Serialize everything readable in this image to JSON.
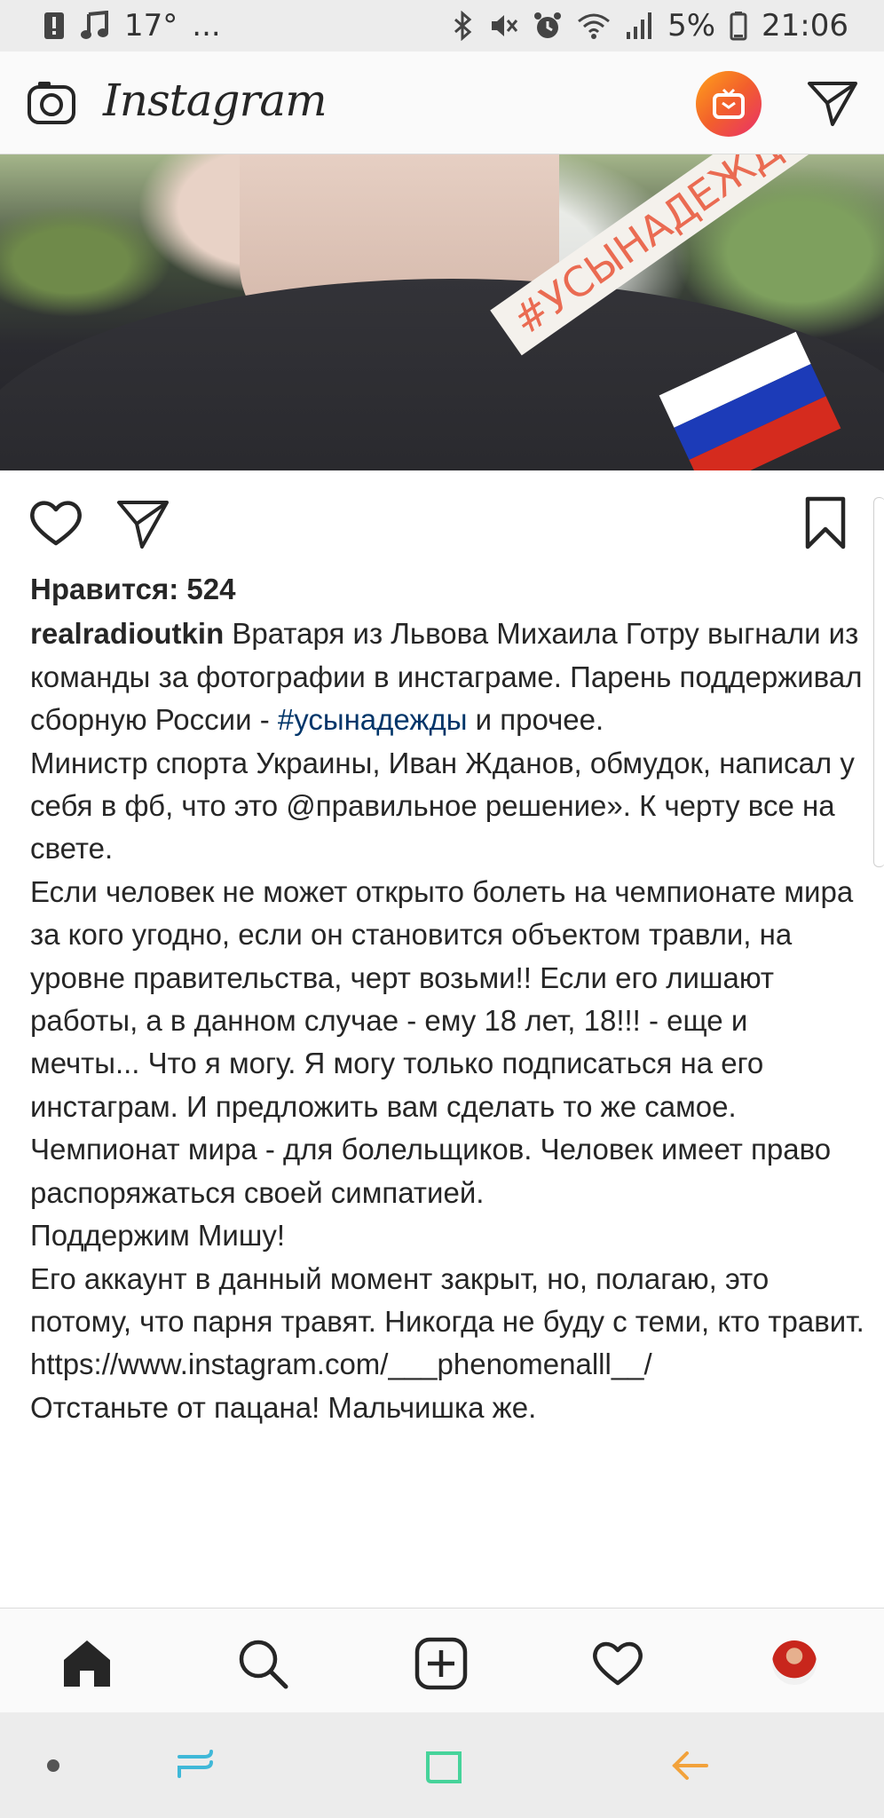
{
  "status_bar": {
    "temperature": "17°",
    "more": "...",
    "battery_percent": "5%",
    "time": "21:06"
  },
  "header": {
    "logo_text": "Instagram"
  },
  "photo": {
    "sticker_text": "#УСЫНАДЕЖДЫ",
    "flag_colors": [
      "#ffffff",
      "#1c3bb8",
      "#d52b1e"
    ]
  },
  "post": {
    "likes": "Нравится: 524",
    "username": "realradioutkin",
    "caption_intro": "Вратаря из Львова Михаила Готру выгнали из команды за фотографии в инстаграме. Парень поддерживал сборную России -",
    "hashtag": "#усынадежды",
    "caption_after_hashtag": "и прочее.",
    "lines": [
      "Министр спорта Украины, Иван Жданов, обмудок, написал у себя в фб, что это @правильное решение». К черту все на свете.",
      "Если человек не может открыто болеть на чемпионате мира за кого угодно, если он становится объектом травли, на уровне правительства, черт возьми!! Если его лишают работы, а в данном случае - ему 18 лет, 18!!! - еще и мечты... Что я могу. Я могу только подписаться на его инстаграм. И предложить вам сделать то же самое.",
      "Чемпионат мира - для болельщиков. Человек имеет право распоряжаться своей симпатией.",
      "Поддержим Мишу!",
      "Его аккаунт в данный момент закрыт, но, полагаю, это потому, что парня травят. Никогда не буду с теми, кто травит.",
      "https://www.instagram.com/___phenomenalll__/",
      "Отстаньте от пацана! Мальчишка же."
    ]
  },
  "colors": {
    "igtv_gradient_start": "#ffa21a",
    "igtv_gradient_end": "#e9306b",
    "hashtag_link": "#003569",
    "sys_nav_recent": "#3fb8d8",
    "sys_nav_home": "#46d39a",
    "sys_nav_back": "#f2a23b"
  }
}
